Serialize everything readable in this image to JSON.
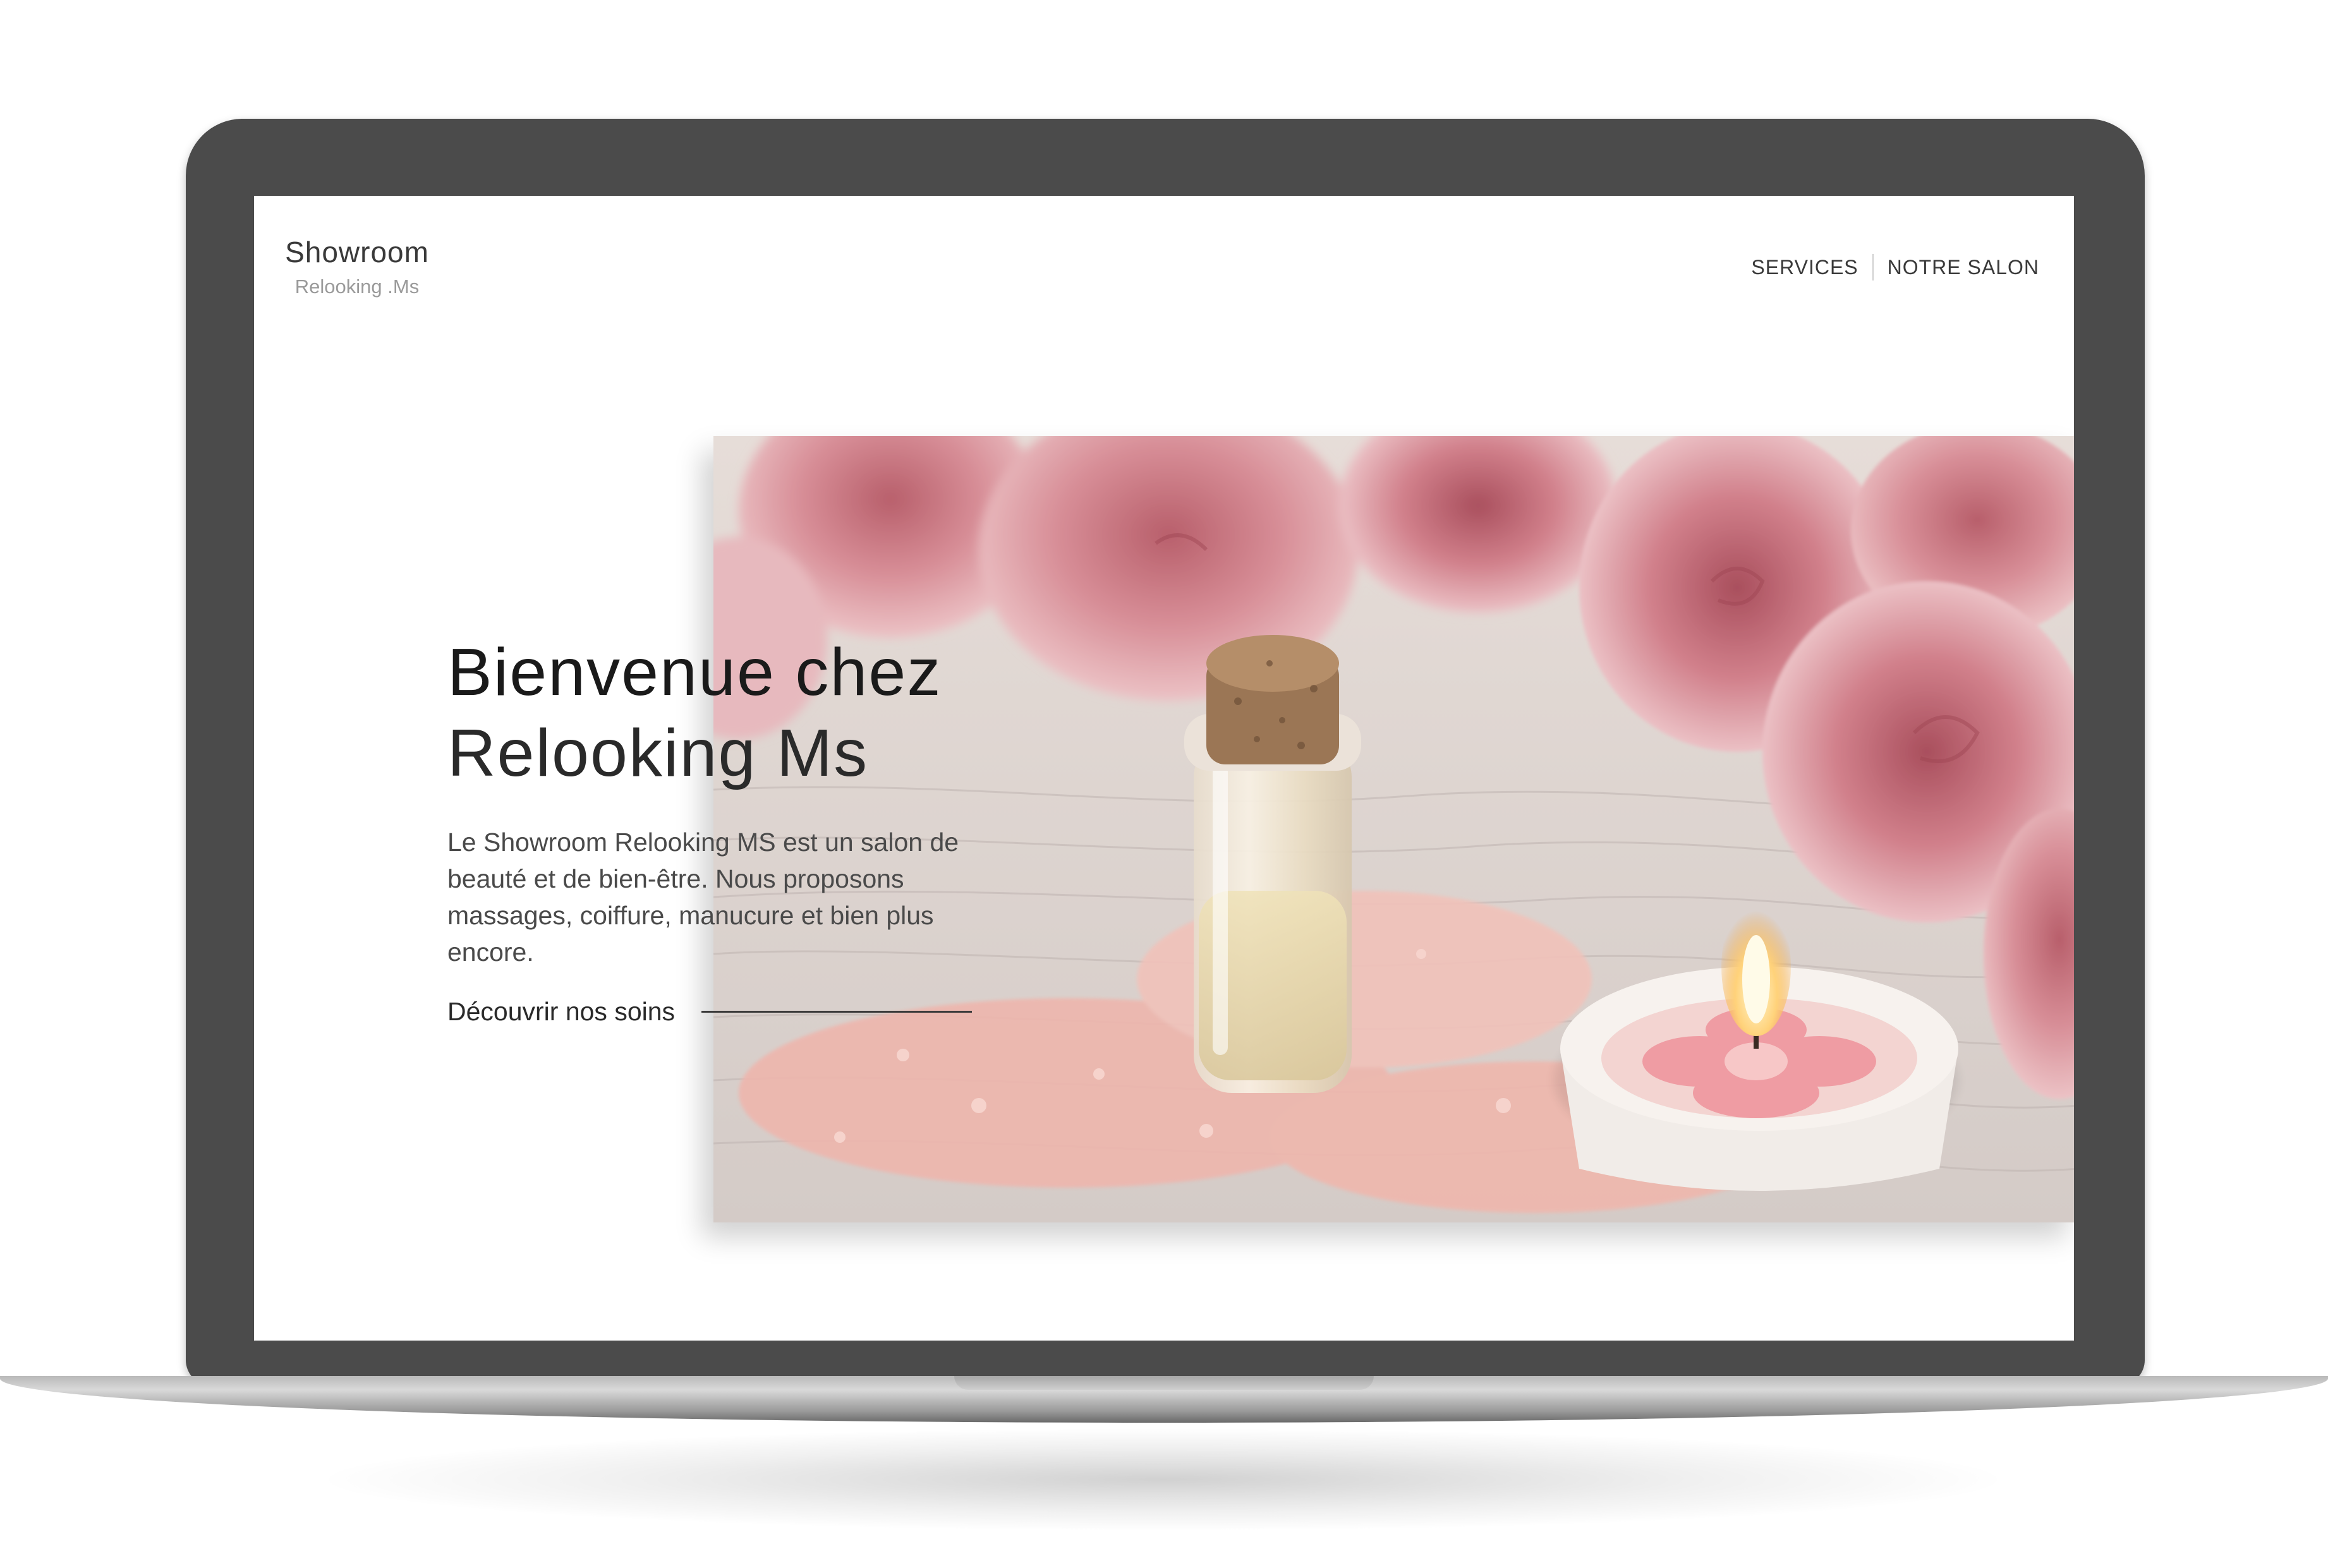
{
  "header": {
    "logo_main": "Showroom",
    "logo_sub": "Relooking .Ms",
    "nav": [
      {
        "label": "SERVICES"
      },
      {
        "label": "NOTRE SALON"
      }
    ]
  },
  "hero": {
    "title_line1": "Bienvenue chez",
    "title_line2": "Relooking Ms",
    "description": "Le Showroom Relooking MS est un salon de beauté et de bien-être. Nous proposons massages, coiffure, manucure et bien plus encore.",
    "cta_label": "Découvrir nos soins",
    "image_icon": "spa-roses-photo"
  },
  "colors": {
    "bezel": "#4b4b4b",
    "rose": "#d98c95",
    "text_dark": "#1a1a1a"
  }
}
